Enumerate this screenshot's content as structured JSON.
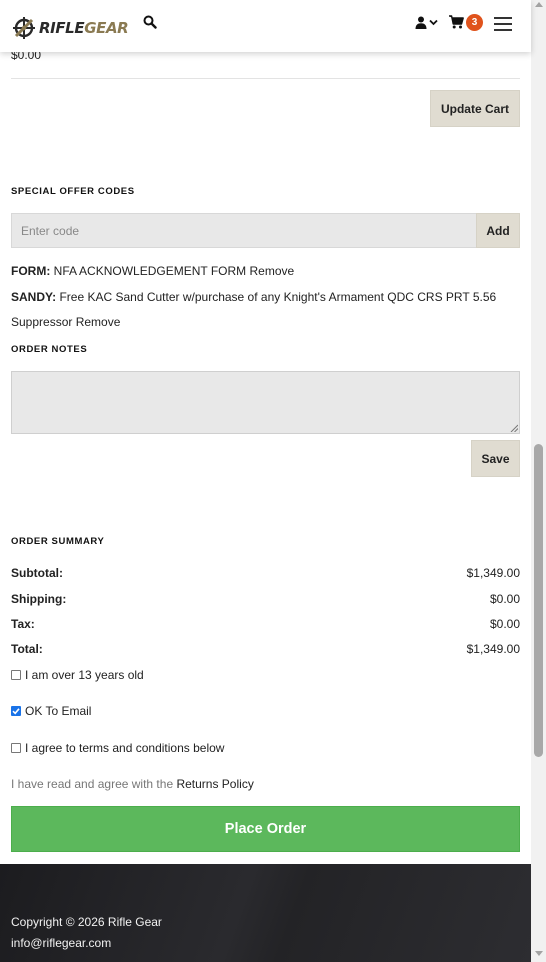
{
  "header": {
    "logo_rifle": "RIFLE",
    "logo_gear": "GEAR",
    "cart_count": "3",
    "icons": [
      "search-icon",
      "user-icon",
      "chevron-down-icon",
      "cart-icon",
      "hamburger-menu-icon"
    ]
  },
  "cart": {
    "partial_line_total": "$0.00",
    "update_cart_label": "Update Cart"
  },
  "special_offers": {
    "title": "SPECIAL OFFER CODES",
    "placeholder": "Enter code",
    "add_label": "Add",
    "applied": [
      {
        "code": "FORM:",
        "description": "NFA ACKNOWLEDGEMENT FORM",
        "remove_label": "Remove"
      },
      {
        "code": "SANDY:",
        "description": "Free KAC Sand Cutter w/purchase of any Knight's Armament QDC CRS PRT 5.56",
        "description_line2": "Suppressor",
        "remove_label": "Remove"
      }
    ]
  },
  "order_notes": {
    "title": "ORDER NOTES",
    "value": "",
    "save_label": "Save"
  },
  "summary": {
    "title": "ORDER SUMMARY",
    "rows": [
      {
        "label": "Subtotal:",
        "value": "$1,349.00"
      },
      {
        "label": "Shipping:",
        "value": "$0.00"
      },
      {
        "label": "Tax:",
        "value": "$0.00"
      },
      {
        "label": "Total:",
        "value": "$1,349.00"
      }
    ]
  },
  "checkboxes": [
    {
      "label": "I am over 13 years old",
      "checked": false
    },
    {
      "label": "OK To Email",
      "checked": true
    },
    {
      "label": "I agree to terms and conditions below",
      "checked": false
    }
  ],
  "policy": {
    "text": "I have read and agree with the ",
    "link": "Returns Policy"
  },
  "place_order_label": "Place Order",
  "footer": {
    "copyright": "Copyright © 2026 Rifle Gear",
    "email": "info@riflegear.com"
  },
  "colors": {
    "accent_green": "#5cb85c",
    "button_beige": "#e0dcd1",
    "cart_badge": "#e0531c",
    "footer_dark": "#1c1c1f",
    "brand_gear": "#8a7a52"
  }
}
